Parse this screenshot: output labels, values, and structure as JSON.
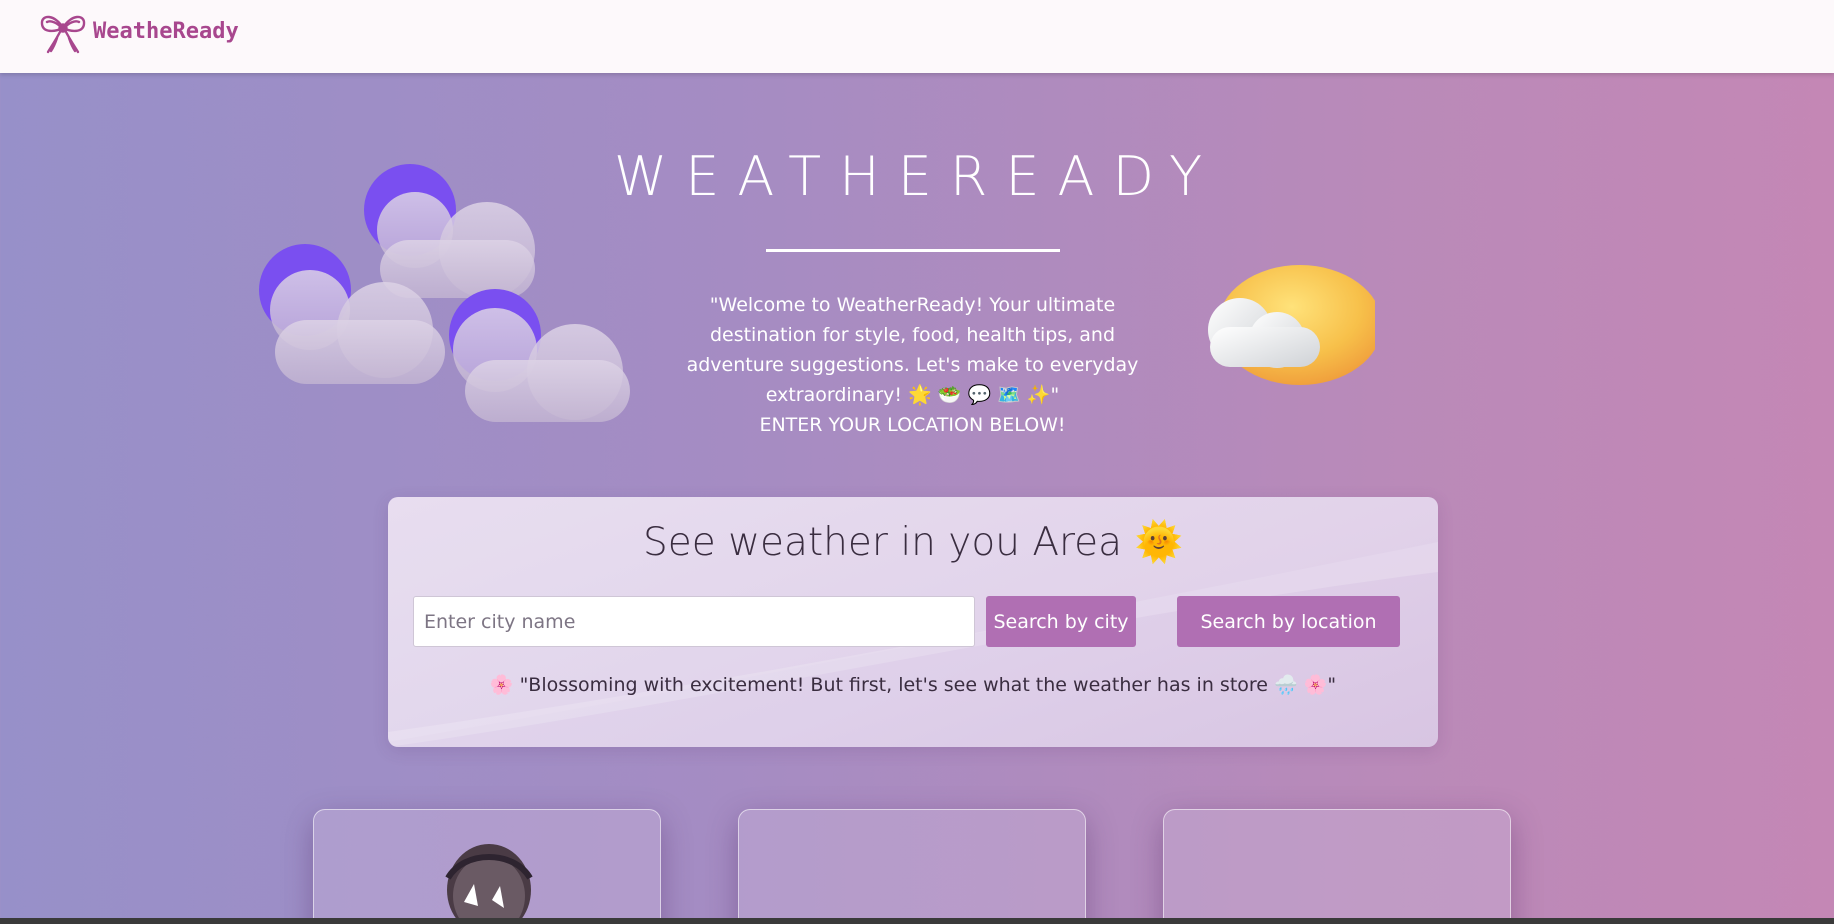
{
  "navbar": {
    "brand_name": "WeatheReady",
    "logo_icon": "bow-icon"
  },
  "hero": {
    "title": "WEATHEREADY",
    "welcome": "\"Welcome to WeatherReady! Your ultimate destination for style, food, health tips, and adventure suggestions. Let's make to everyday extraordinary! 🌟 🥗 💬 🗺️ ✨\"",
    "cta": "ENTER YOUR LOCATION BELOW!"
  },
  "search_card": {
    "title": "See weather in you Area",
    "title_emoji": "🌞",
    "input_placeholder": "Enter city name",
    "input_value": "",
    "search_city_label": "Search by city",
    "search_location_label": "Search by location",
    "quote": "🌸 \"Blossoming with excitement! But first, let's see what the weather has in store 🌧️ 🌸\""
  },
  "colors": {
    "brand": "#a8478e",
    "button": "#b06fb3",
    "moon": "#7a4ff0"
  }
}
